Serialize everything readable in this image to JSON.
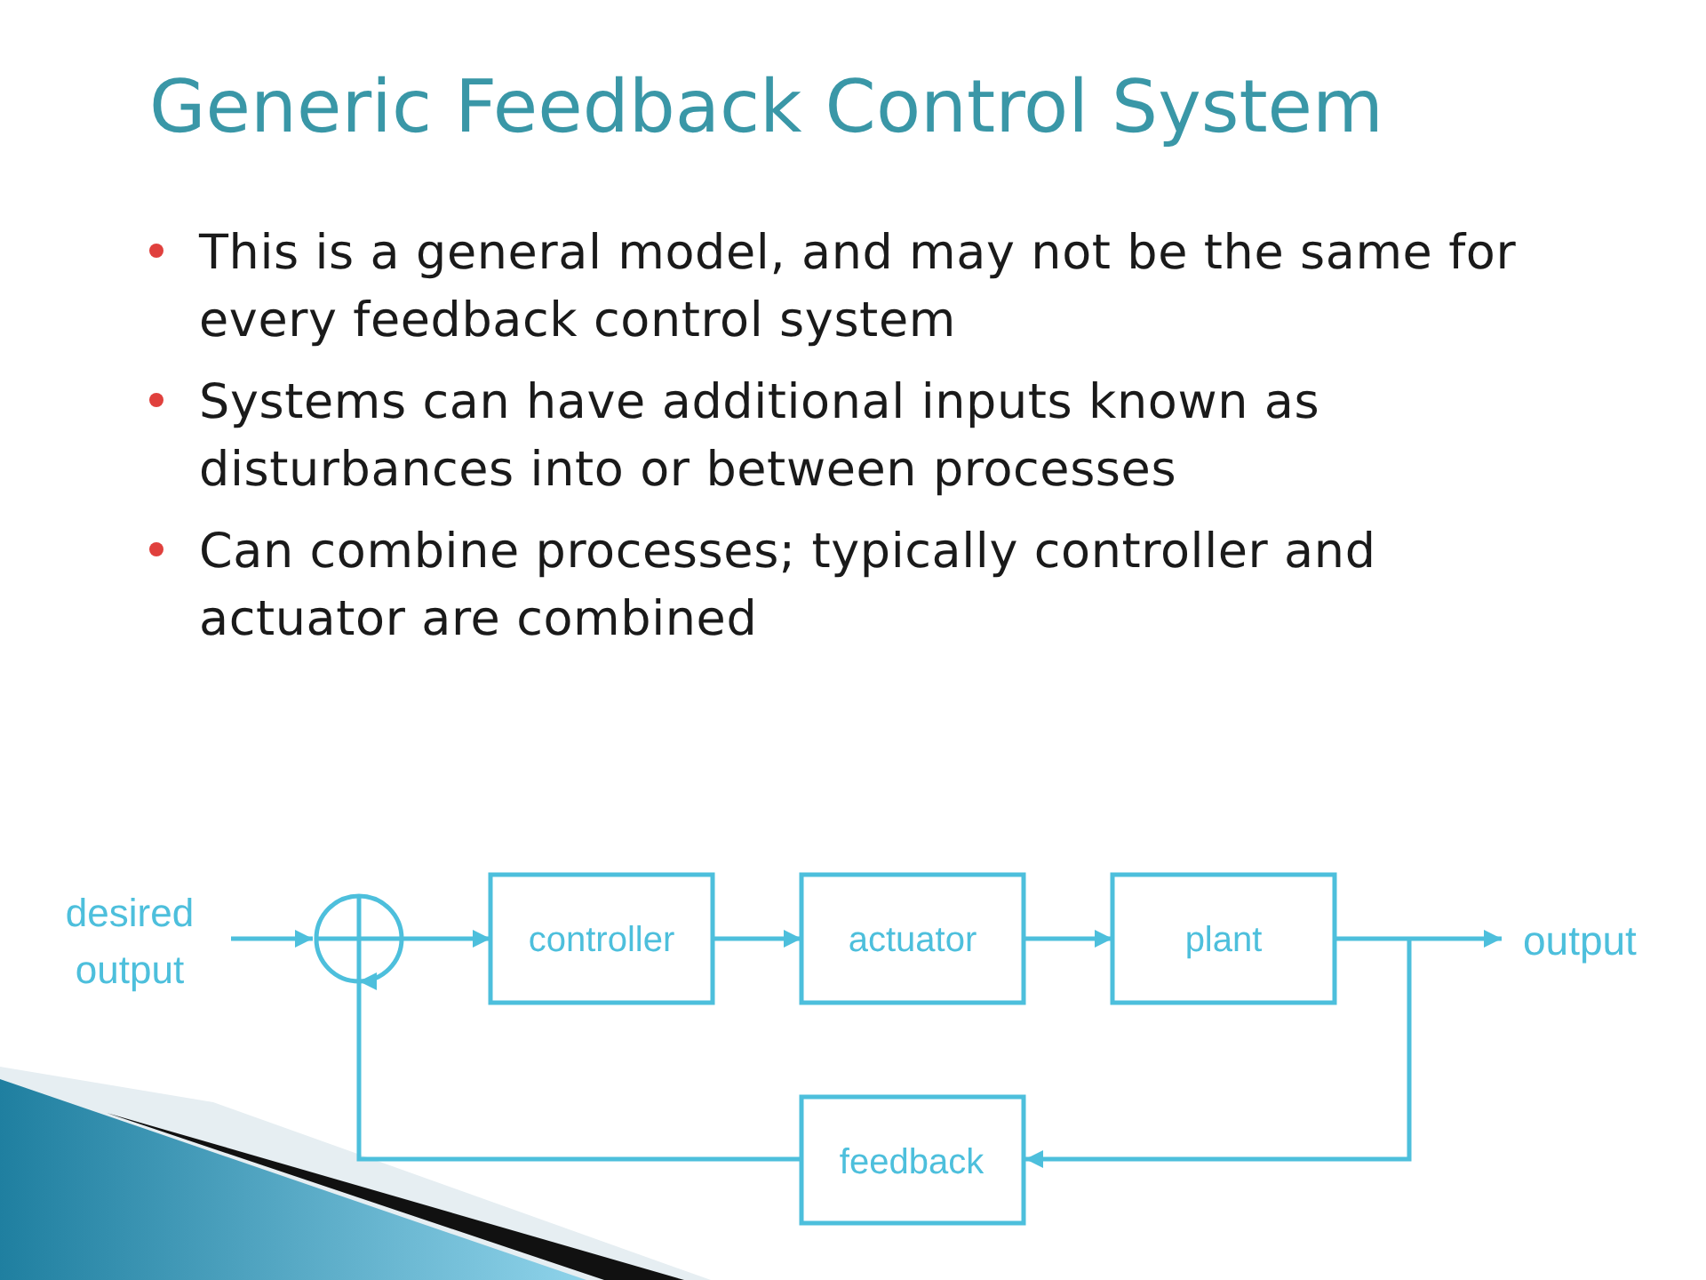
{
  "title": "Generic Feedback Control System",
  "bullets": [
    {
      "text": "This is a general model, and may not be the same for every feedback control system"
    },
    {
      "text": "Systems can have additional inputs known as disturbances into or between processes"
    },
    {
      "text": "Can combine processes; typically controller and actuator are combined"
    }
  ],
  "diagram": {
    "input_label_lines": [
      "desired",
      "output"
    ],
    "forward_blocks": [
      {
        "label": "controller"
      },
      {
        "label": "actuator"
      },
      {
        "label": "plant"
      }
    ],
    "feedback_block": {
      "label": "feedback"
    },
    "output_label": "output"
  }
}
